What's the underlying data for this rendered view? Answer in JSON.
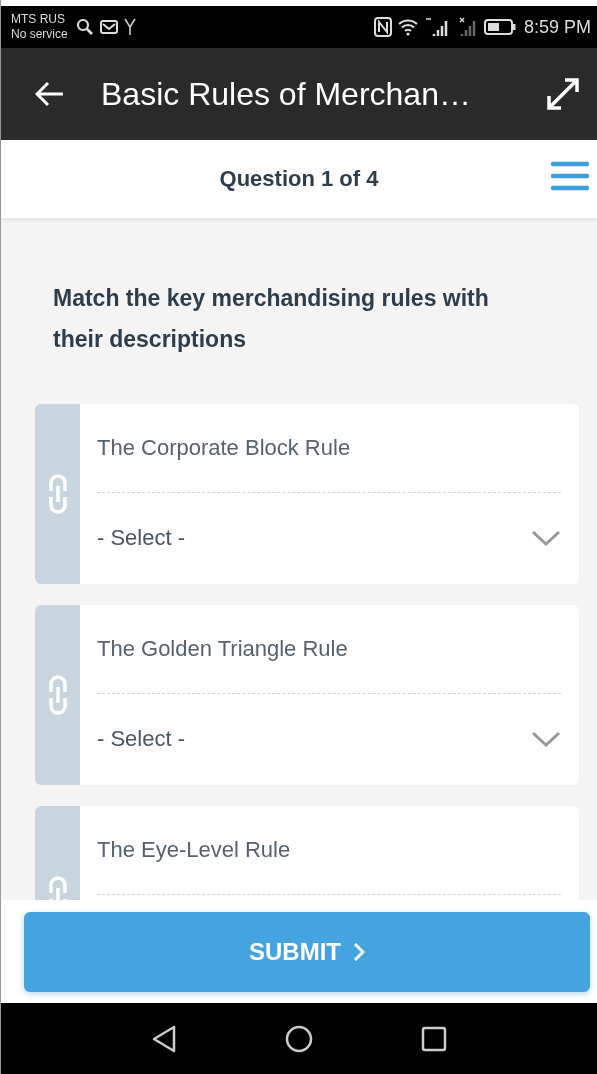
{
  "status_bar": {
    "carrier": "MTS RUS",
    "service": "No service",
    "time": "8:59 PM"
  },
  "app_bar": {
    "title": "Basic Rules of Merchan…"
  },
  "question_header": {
    "title": "Question 1 of 4"
  },
  "question": {
    "text": "Match the key merchandising rules with their descriptions"
  },
  "items": [
    {
      "label": "The Corporate Block Rule",
      "select": "- Select -"
    },
    {
      "label": "The Golden Triangle Rule",
      "select": "- Select -"
    },
    {
      "label": "The Eye-Level Rule"
    }
  ],
  "submit": {
    "label": "SUBMIT"
  }
}
